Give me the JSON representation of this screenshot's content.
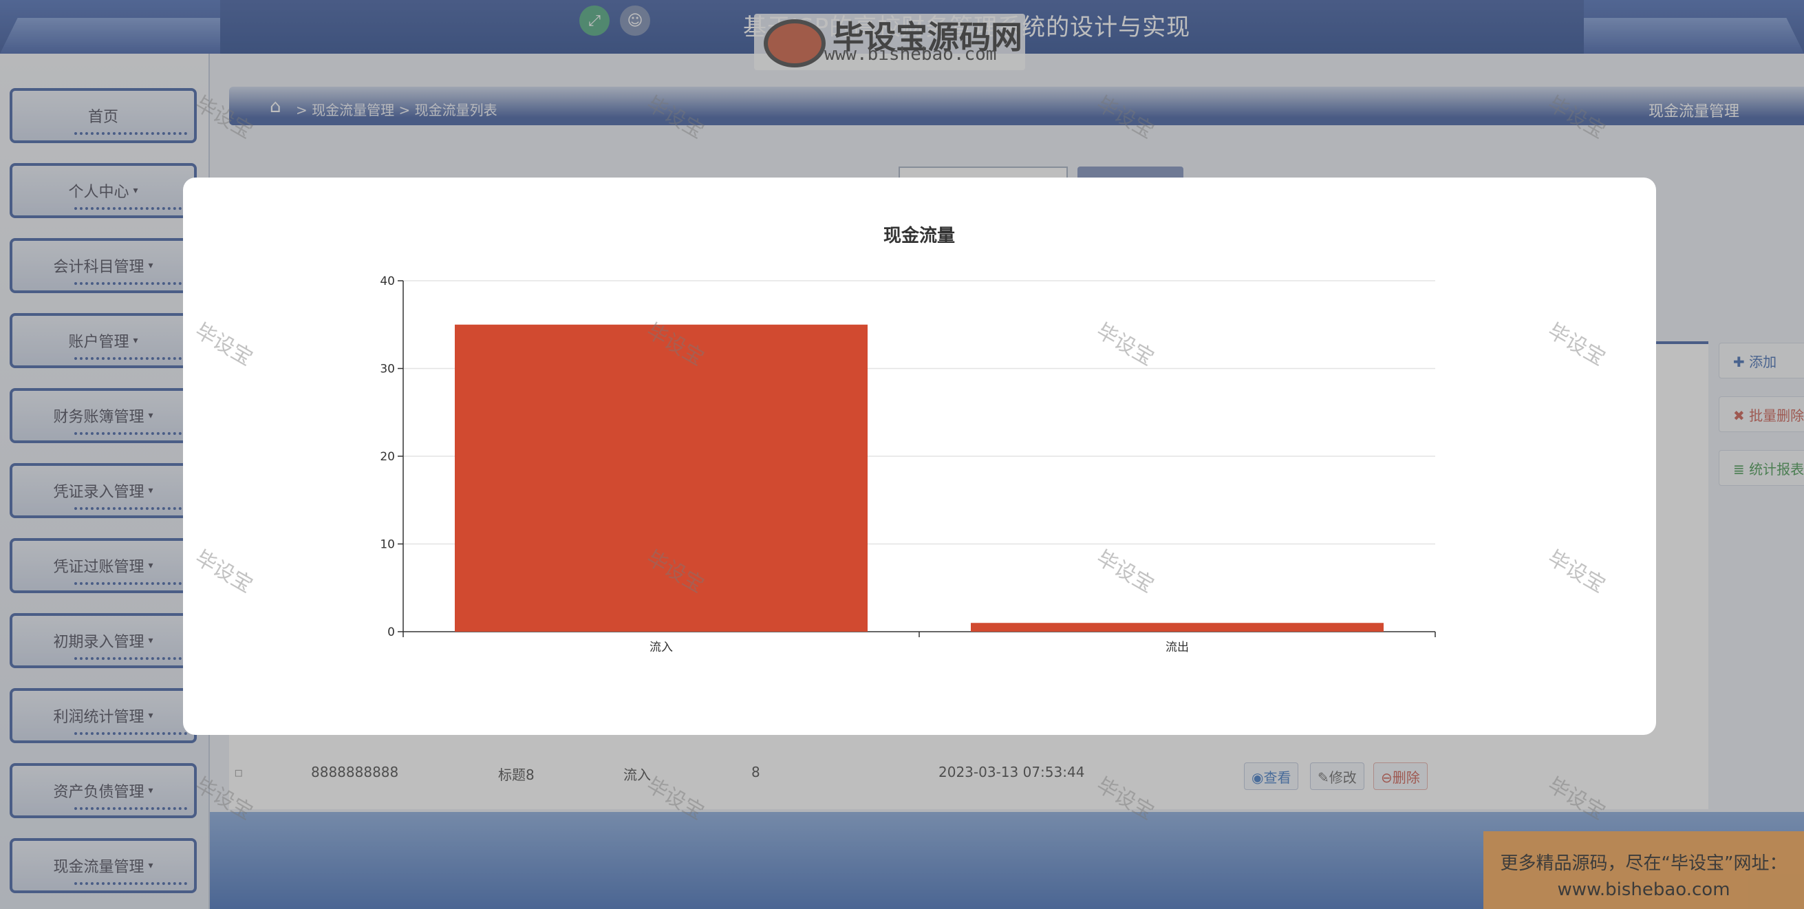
{
  "header": {
    "title": "基于JSP的高校财务管理系统的设计与实现",
    "logo_name": "毕设宝源码网",
    "logo_url": "www.bishebao.com",
    "fullscreen_icon": "expand-icon",
    "user_icon": "user-icon"
  },
  "sidebar": {
    "items": [
      {
        "label": "首页",
        "caret": ""
      },
      {
        "label": "个人中心",
        "caret": "▾"
      },
      {
        "label": "会计科目管理",
        "caret": "▾"
      },
      {
        "label": "账户管理",
        "caret": "▾"
      },
      {
        "label": "财务账簿管理",
        "caret": "▾"
      },
      {
        "label": "凭证录入管理",
        "caret": "▾"
      },
      {
        "label": "凭证过账管理",
        "caret": "▾"
      },
      {
        "label": "初期录入管理",
        "caret": "▾"
      },
      {
        "label": "利润统计管理",
        "caret": "▾"
      },
      {
        "label": "资产负债管理",
        "caret": "▾"
      },
      {
        "label": "现金流量管理",
        "caret": "▾"
      }
    ]
  },
  "breadcrumb": {
    "home_icon": "⌂",
    "path": "> 现金流量管理 > 现金流量列表",
    "right_title": "现金流量管理"
  },
  "actions": {
    "add": "✚ 添加",
    "batch_delete": "✖ 批量删除",
    "report": "≣ 统计报表"
  },
  "table_row": {
    "checkbox": "▫",
    "code": "8888888888",
    "title": "标题8",
    "type": "流入",
    "amount": "8",
    "time": "2023-03-13 07:53:44",
    "view": "◉查看",
    "edit": "✎修改",
    "delete": "⊖删除"
  },
  "promo": {
    "line1": "更多精品源码，尽在“毕设宝”网址：",
    "line2": "www.bishebao.com"
  },
  "watermark_text": "毕设宝",
  "chart_data": {
    "type": "bar",
    "title": "现金流量",
    "categories": [
      "流入",
      "流出"
    ],
    "values": [
      35,
      1
    ],
    "ylim": [
      0,
      40
    ],
    "yticks": [
      0,
      10,
      20,
      30,
      40
    ],
    "xlabel": "",
    "ylabel": "",
    "grid": true,
    "bar_color": "#d14a30"
  }
}
